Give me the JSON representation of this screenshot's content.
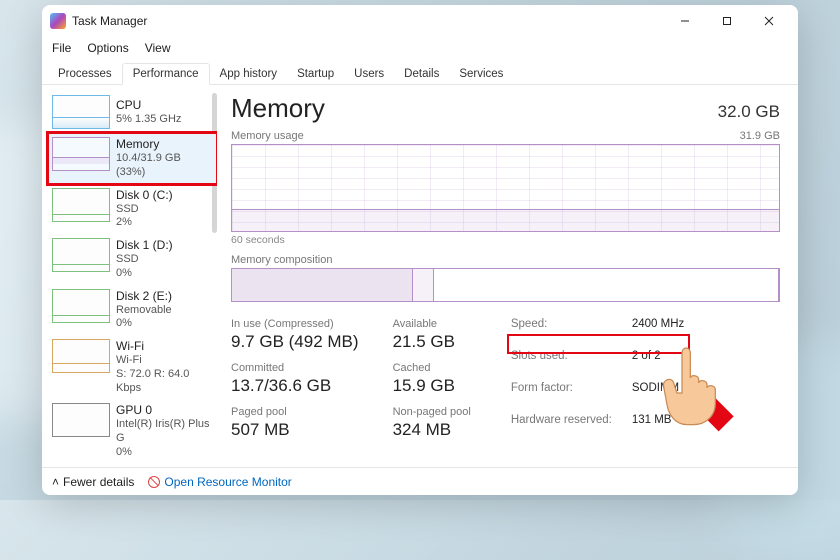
{
  "window": {
    "title": "Task Manager"
  },
  "menu": {
    "file": "File",
    "options": "Options",
    "view": "View"
  },
  "tabs": {
    "processes": "Processes",
    "performance": "Performance",
    "app_history": "App history",
    "startup": "Startup",
    "users": "Users",
    "details": "Details",
    "services": "Services"
  },
  "sidebar": {
    "cpu": {
      "title": "CPU",
      "sub": "5%  1.35 GHz"
    },
    "memory": {
      "title": "Memory",
      "sub": "10.4/31.9 GB (33%)"
    },
    "disk0": {
      "title": "Disk 0 (C:)",
      "sub1": "SSD",
      "sub2": "2%"
    },
    "disk1": {
      "title": "Disk 1 (D:)",
      "sub1": "SSD",
      "sub2": "0%"
    },
    "disk2": {
      "title": "Disk 2 (E:)",
      "sub1": "Removable",
      "sub2": "0%"
    },
    "wifi": {
      "title": "Wi-Fi",
      "sub1": "Wi-Fi",
      "sub2": "S: 72.0  R: 64.0 Kbps"
    },
    "gpu": {
      "title": "GPU 0",
      "sub1": "Intel(R) Iris(R) Plus G",
      "sub2": "0%"
    }
  },
  "main": {
    "heading": "Memory",
    "capacity": "32.0 GB",
    "usage_label": "Memory usage",
    "usage_max": "31.9 GB",
    "usage_time": "60 seconds",
    "composition_label": "Memory composition",
    "stats": {
      "in_use": {
        "label": "In use (Compressed)",
        "value": "9.7 GB (492 MB)"
      },
      "available": {
        "label": "Available",
        "value": "21.5 GB"
      },
      "committed": {
        "label": "Committed",
        "value": "13.7/36.6 GB"
      },
      "cached": {
        "label": "Cached",
        "value": "15.9 GB"
      },
      "paged": {
        "label": "Paged pool",
        "value": "507 MB"
      },
      "nonpaged": {
        "label": "Non-paged pool",
        "value": "324 MB"
      }
    },
    "right": {
      "speed": {
        "label": "Speed:",
        "value": "2400 MHz"
      },
      "slots": {
        "label": "Slots used:",
        "value": "2 of 2"
      },
      "form": {
        "label": "Form factor:",
        "value": "SODIMM"
      },
      "hw": {
        "label": "Hardware reserved:",
        "value": "131 MB"
      }
    }
  },
  "footer": {
    "fewer": "Fewer details",
    "orm": "Open Resource Monitor"
  },
  "colors": {
    "accent_memory": "#b48fc8",
    "highlight": "#e30613"
  }
}
